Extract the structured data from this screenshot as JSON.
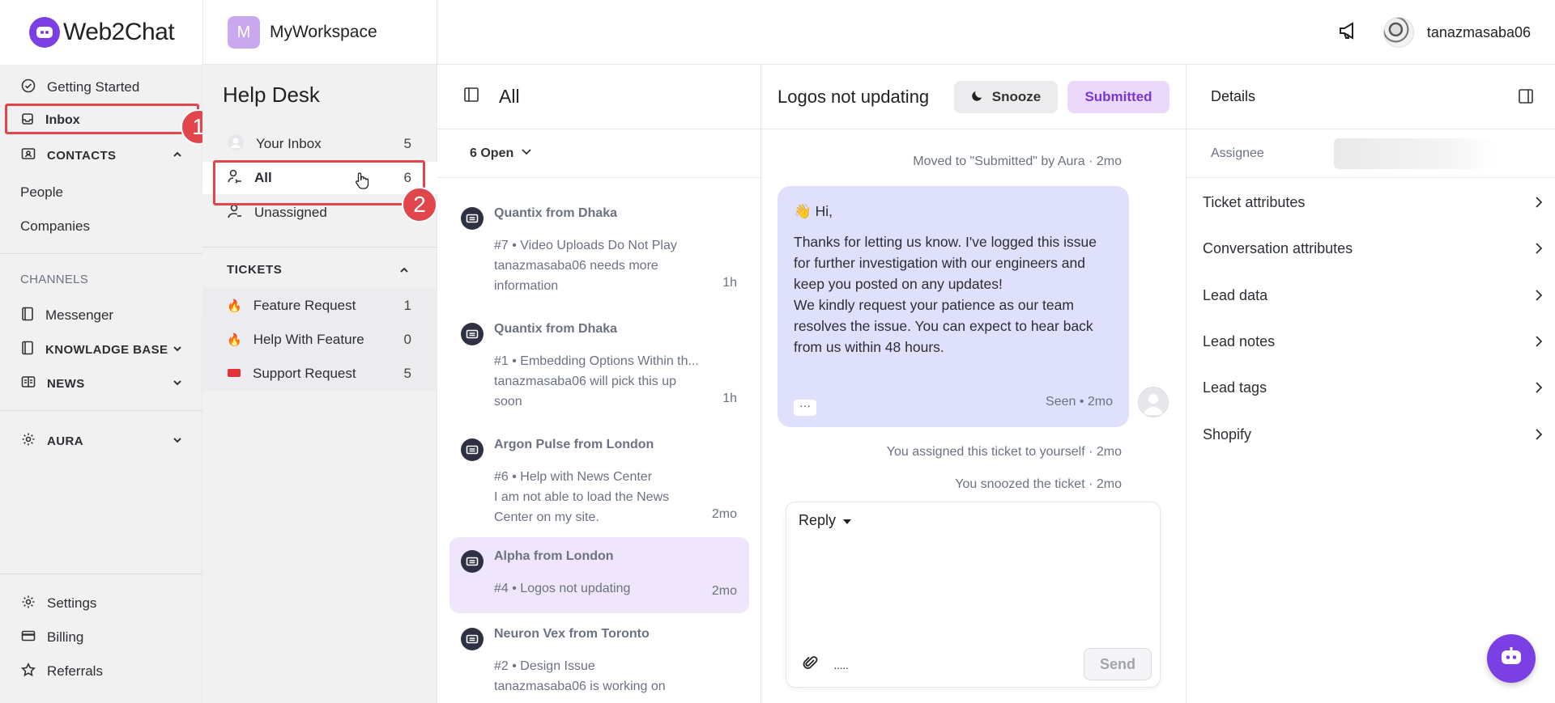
{
  "brand": {
    "name": "Web2Chat"
  },
  "workspace": {
    "initial": "M",
    "name": "MyWorkspace"
  },
  "user": {
    "name": "tanazmasaba06"
  },
  "leftnav": {
    "getting_started": "Getting Started",
    "inbox": "Inbox",
    "contacts": "CONTACTS",
    "people": "People",
    "companies": "Companies",
    "channels": "CHANNELS",
    "messenger": "Messenger",
    "knowledge_base": "KNOWLADGE BASE",
    "news": "NEWS",
    "aura": "AURA",
    "settings": "Settings",
    "billing": "Billing",
    "referrals": "Referrals"
  },
  "annotations": {
    "one": "1",
    "two": "2"
  },
  "helpdesk": {
    "title": "Help Desk",
    "your_inbox": {
      "label": "Your Inbox",
      "count": "5"
    },
    "all": {
      "label": "All",
      "count": "6"
    },
    "unassigned": {
      "label": "Unassigned"
    },
    "tickets_section": "TICKETS",
    "tickets": [
      {
        "label": "Feature Request",
        "count": "1"
      },
      {
        "label": "Help With Feature",
        "count": "0"
      },
      {
        "label": "Support Request",
        "count": "5"
      }
    ]
  },
  "convlist": {
    "title": "All",
    "filter": "6 Open",
    "items": [
      {
        "name": "Quantix from Dhaka",
        "line1": "#7 • Video Uploads Do Not Play",
        "line2": "tanazmasaba06 needs more",
        "line3": "information",
        "time": "1h"
      },
      {
        "name": "Quantix from Dhaka",
        "line1": "#1 • Embedding Options Within th...",
        "line2": "tanazmasaba06 will pick this up",
        "line3": "soon",
        "time": "1h"
      },
      {
        "name": "Argon Pulse from London",
        "line1": "#6 • Help with News Center",
        "line2": "I am not able to load the News",
        "line3": "Center on my site.",
        "time": "2mo"
      },
      {
        "name": "Alpha from London",
        "line1": "#4 • Logos not updating",
        "time": "2mo"
      },
      {
        "name": "Neuron Vex from Toronto",
        "line1": "#2 • Design Issue",
        "line2": "tanazmasaba06 is working on"
      }
    ]
  },
  "chat": {
    "title": "Logos not updating",
    "snooze": "Snooze",
    "status": "Submitted",
    "sys1": "Moved to \"Submitted\" by Aura · 2mo",
    "msg_greeting": "👋 Hi,",
    "msg_body1": "Thanks for letting us know. I've logged this issue for further investigation with our engineers and keep you posted on any updates!",
    "msg_body2": "We kindly request your patience as our team resolves the issue. You can expect to hear back from us within 48 hours.",
    "more": "···",
    "seen": "Seen • 2mo",
    "sys2": "You assigned this ticket to yourself · 2mo",
    "sys3": "You snoozed the ticket · 2mo",
    "reply_label": "Reply",
    "toolbar_dots": "·····",
    "send": "Send"
  },
  "details": {
    "title": "Details",
    "assignee_label": "Assignee",
    "items": [
      "Ticket attributes",
      "Conversation attributes",
      "Lead data",
      "Lead notes",
      "Lead tags",
      "Shopify"
    ]
  },
  "colors": {
    "brand": "#7b3fe4",
    "highlight": "#e0464b",
    "selected_bg": "#efe6fb",
    "bubble_bg": "#dfe0fb",
    "submitted": "#7a35d6"
  }
}
